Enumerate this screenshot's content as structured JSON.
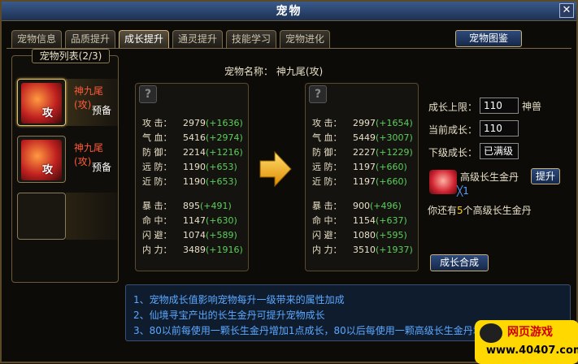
{
  "window": {
    "title": "宠物",
    "close_label": "✕"
  },
  "tabs": [
    "宠物信息",
    "品质提升",
    "成长提升",
    "通灵提升",
    "技能学习",
    "宠物进化"
  ],
  "active_tab": 2,
  "pet_book_label": "宠物图鉴",
  "pet_list": {
    "header": "宠物列表(2/3)",
    "pets": [
      {
        "name": "神九尾(攻)",
        "status": "预备",
        "type_mark": "攻",
        "selected": true
      },
      {
        "name": "神九尾(攻)",
        "status": "预备",
        "type_mark": "攻",
        "selected": false
      }
    ]
  },
  "pet_name_label": "宠物名称：",
  "pet_name": "神九尾(攻)",
  "unknown_mark": "?",
  "stats_current": [
    {
      "label": "攻    击：",
      "value": "2979",
      "bonus": "(+1636)"
    },
    {
      "label": "气    血：",
      "value": "5416",
      "bonus": "(+2974)"
    },
    {
      "label": "防    御：",
      "value": "2214",
      "bonus": "(+1216)"
    },
    {
      "label": "远    防：",
      "value": "1190",
      "bonus": "(+653)"
    },
    {
      "label": "近    防：",
      "value": "1190",
      "bonus": "(+653)"
    },
    {
      "label": "暴    击：",
      "value": "895",
      "bonus": "(+491)"
    },
    {
      "label": "命    中：",
      "value": "1147",
      "bonus": "(+630)"
    },
    {
      "label": "闪    避：",
      "value": "1074",
      "bonus": "(+589)"
    },
    {
      "label": "内    力：",
      "value": "3489",
      "bonus": "(+1916)"
    }
  ],
  "stats_next": [
    {
      "label": "攻    击：",
      "value": "2997",
      "bonus": "(+1654)"
    },
    {
      "label": "气    血：",
      "value": "5449",
      "bonus": "(+3007)"
    },
    {
      "label": "防    御：",
      "value": "2227",
      "bonus": "(+1229)"
    },
    {
      "label": "远    防：",
      "value": "1197",
      "bonus": "(+660)"
    },
    {
      "label": "近    防：",
      "value": "1197",
      "bonus": "(+660)"
    },
    {
      "label": "暴    击：",
      "value": "900",
      "bonus": "(+496)"
    },
    {
      "label": "命    中：",
      "value": "1154",
      "bonus": "(+637)"
    },
    {
      "label": "闪    避：",
      "value": "1080",
      "bonus": "(+595)"
    },
    {
      "label": "内    力：",
      "value": "3510",
      "bonus": "(+1937)"
    }
  ],
  "growth": {
    "limit_label": "成长上限：",
    "limit_value": "110",
    "limit_suffix": "神兽",
    "current_label": "当前成长：",
    "current_value": "110",
    "next_label": "下级成长：",
    "next_value": "已满级"
  },
  "pill": {
    "name": "高级长生金丹",
    "count": "╳1",
    "upgrade_label": "提升"
  },
  "remain": {
    "prefix": "你还有",
    "count": "5",
    "suffix": "个高级长生金丹"
  },
  "merge_label": "成长合成",
  "tips": [
    "1、宠物成长值影响宠物每升一级带来的属性加成",
    "2、仙境寻宝产出的长生金丹可提升宠物成长",
    "3、80以前每使用一颗长生金丹增加1点成长，80以后每使用一颗高级长生金丹增加"
  ],
  "watermark": {
    "title": "网页游戏",
    "url": "www.40407.com"
  }
}
